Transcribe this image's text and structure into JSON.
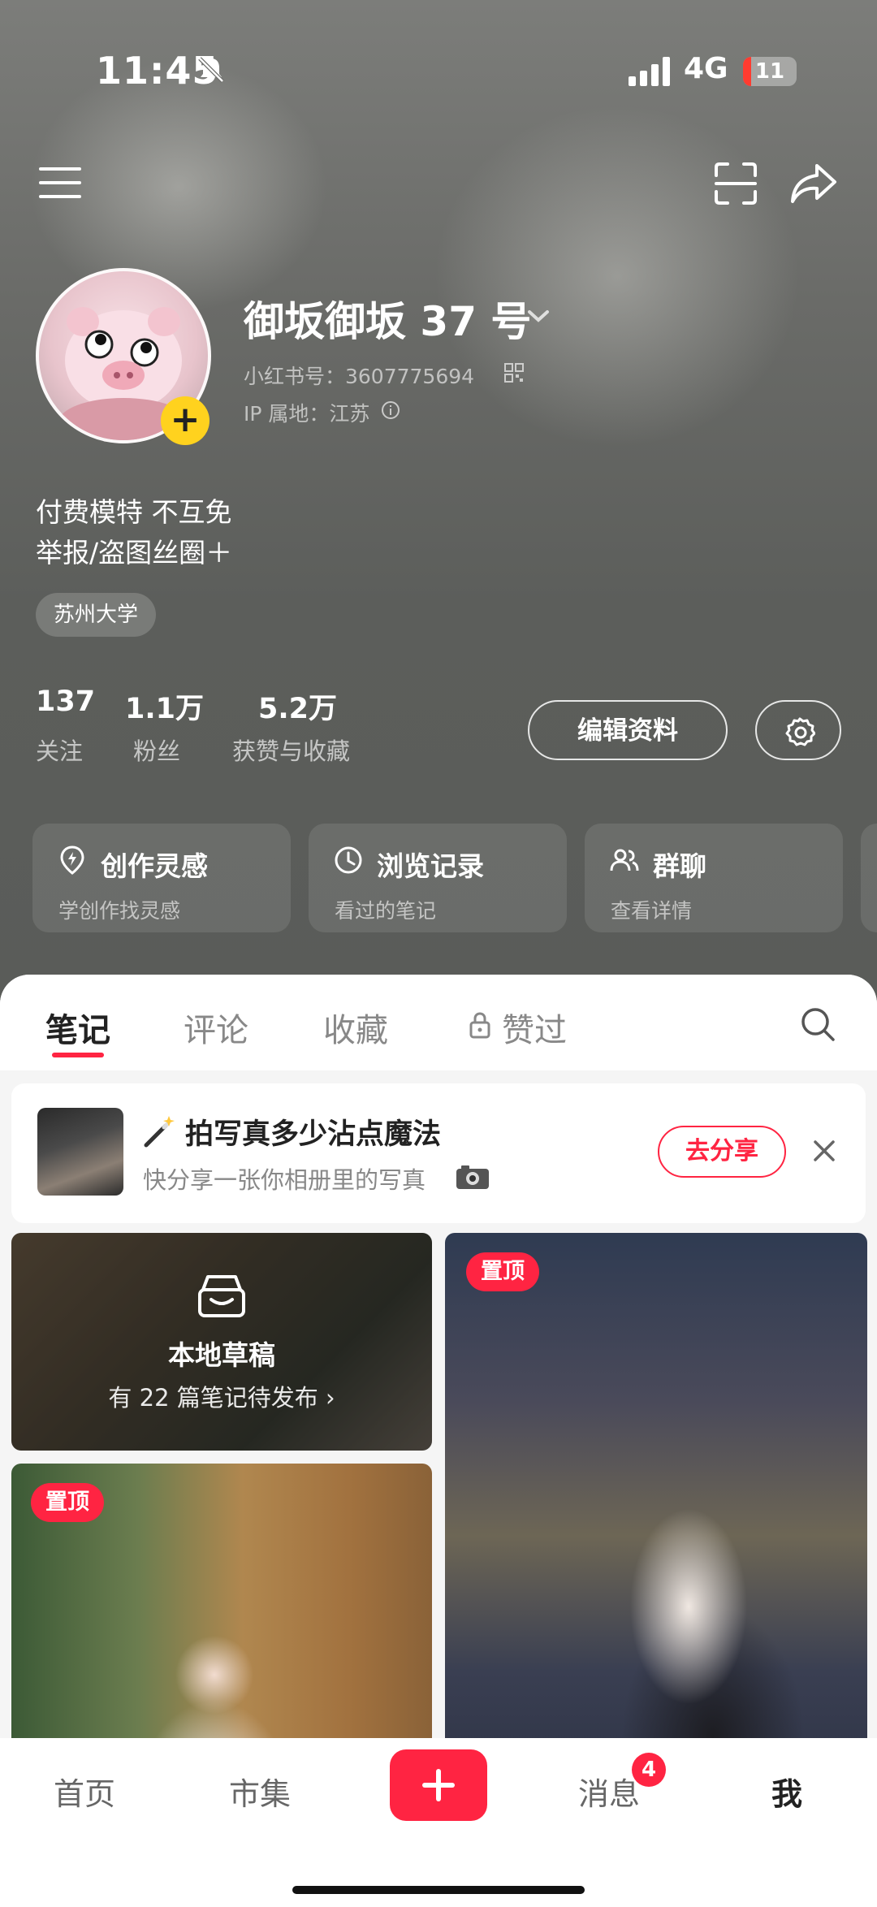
{
  "status_bar": {
    "time": "11:45",
    "network": "4G",
    "battery": "11"
  },
  "profile": {
    "username": "御坂御坂 37 号",
    "account_id": "小红书号：3607775694",
    "ip_location": "IP 属地：江苏",
    "bio_line1": "付费模特 不互免",
    "bio_line2": "举报/盗图丝圈＋",
    "tag": "苏州大学",
    "avatar_add_symbol": "+"
  },
  "stats": [
    {
      "value": "137",
      "label": "关注"
    },
    {
      "value": "1.1万",
      "label": "粉丝"
    },
    {
      "value": "5.2万",
      "label": "获赞与收藏"
    }
  ],
  "actions": {
    "edit_profile": "编辑资料"
  },
  "shortcuts": [
    {
      "title": "创作灵感",
      "subtitle": "学创作找灵感",
      "icon": "lightbulb-pin-icon"
    },
    {
      "title": "浏览记录",
      "subtitle": "看过的笔记",
      "icon": "clock-icon"
    },
    {
      "title": "群聊",
      "subtitle": "查看详情",
      "icon": "group-icon"
    }
  ],
  "tabs": [
    {
      "label": "笔记",
      "active": true
    },
    {
      "label": "评论",
      "active": false
    },
    {
      "label": "收藏",
      "active": false
    },
    {
      "label": "赞过",
      "active": false,
      "locked": true
    }
  ],
  "promo": {
    "title": "拍写真多少沾点魔法",
    "subtitle": "快分享一张你相册里的写真",
    "button": "去分享"
  },
  "draft_card": {
    "title": "本地草稿",
    "subtitle": "有 22 篇笔记待发布 ›"
  },
  "pinned_label": "置顶",
  "bottom_nav": [
    {
      "label": "首页",
      "active": false
    },
    {
      "label": "市集",
      "active": false
    },
    {
      "label": "消息",
      "active": false,
      "badge": "4"
    },
    {
      "label": "我",
      "active": true
    }
  ],
  "colors": {
    "accent": "#ff2442",
    "avatar_add": "#ffd21e",
    "hero_bg": "#5a5c59"
  }
}
